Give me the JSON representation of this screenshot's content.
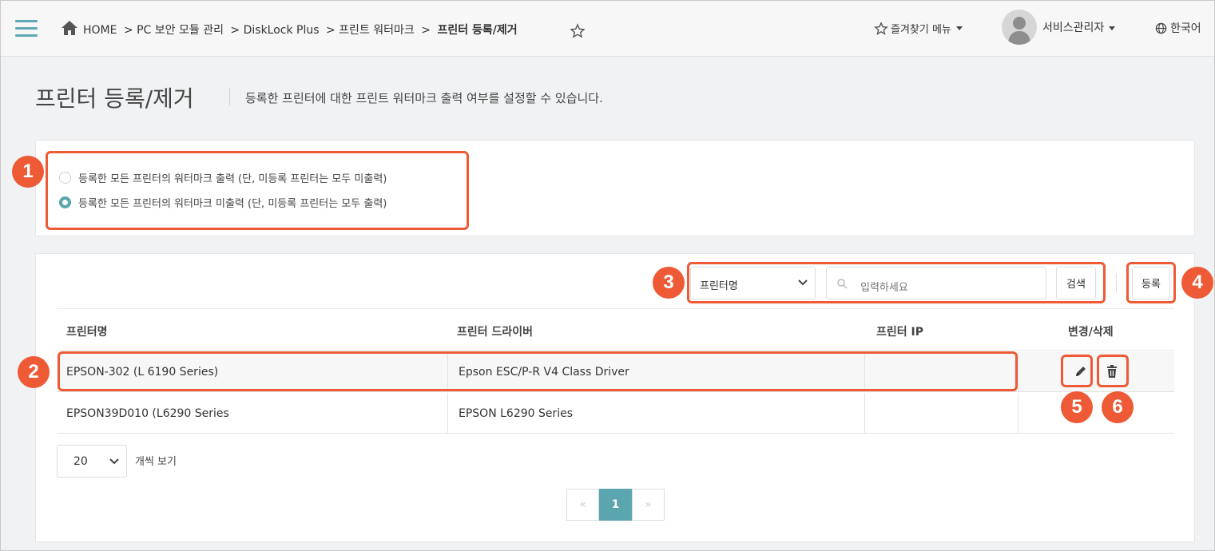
{
  "header": {
    "breadcrumb": [
      "HOME",
      "> PC 보안 모듈 관리",
      "> DiskLock Plus",
      "> 프린트 워터마크",
      ">"
    ],
    "breadcrumb_current": "프린터 등록/제거",
    "favorites_label": "즐겨찾기 메뉴",
    "user_name": "서비스관리자",
    "language": "한국어"
  },
  "page": {
    "title": "프린터 등록/제거",
    "description": "등록한 프린터에 대한 프린트 워터마크 출력 여부를 설정할 수 있습니다."
  },
  "options": [
    {
      "label": "등록한 모든 프린터의 워터마크 출력 (단, 미등록 프린터는 모두 미출력)",
      "checked": false
    },
    {
      "label": "등록한 모든 프린터의 워터마크 미출력 (단, 미등록 프린터는 모두 출력)",
      "checked": true
    }
  ],
  "search": {
    "field_selected": "프린터명",
    "placeholder": "입력하세요",
    "search_button": "검색",
    "register_button": "등록"
  },
  "table": {
    "columns": [
      "프린터명",
      "프린터 드라이버",
      "프린터 IP",
      "변경/삭제"
    ],
    "rows": [
      {
        "name": "EPSON-302 (L 6190 Series)",
        "driver": "Epson ESC/P-R V4 Class Driver",
        "ip": ""
      },
      {
        "name": "EPSON39D010 (L6290 Series",
        "driver": "EPSON L6290 Series",
        "ip": ""
      }
    ]
  },
  "pagination": {
    "per_page": "20",
    "per_page_label": "개씩 보기",
    "prev": "«",
    "current": "1",
    "next": "»"
  },
  "callouts": [
    "1",
    "2",
    "3",
    "4",
    "5",
    "6"
  ],
  "colors": {
    "accent": "#5ba5ae",
    "callout": "#ee5a36"
  }
}
